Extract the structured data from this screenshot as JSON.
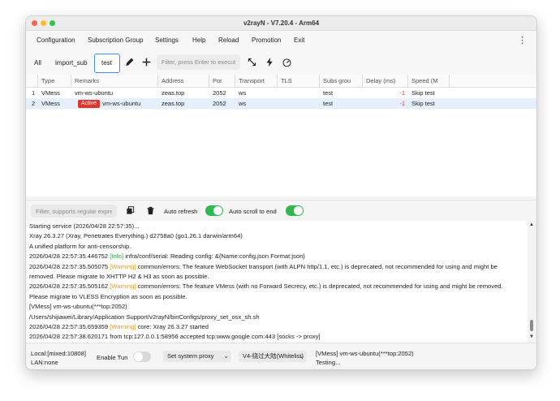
{
  "window": {
    "title": "v2rayN - V7.20.4 - Arm64"
  },
  "menu": [
    "Configuration",
    "Subscription Group",
    "Settings",
    "Help",
    "Reload",
    "Promotion",
    "Exit"
  ],
  "tabs": [
    "All",
    "import_sub",
    "test"
  ],
  "toolbar": {
    "filter_placeholder": "Filter, press Enter to execute"
  },
  "table": {
    "headers": [
      "Type",
      "Remarks",
      "Address",
      "Por",
      "Transport",
      "TLS",
      "Subs grou",
      "Delay (ms)",
      "Speed (M"
    ],
    "rows": [
      {
        "index": "1",
        "type": "VMess",
        "badge": "",
        "remarks": "vm-ws-ubuntu",
        "address": "zeas.top",
        "port": "2052",
        "transport": "ws",
        "tls": "",
        "subs": "test",
        "delay": "-1",
        "speed": "Skip test"
      },
      {
        "index": "2",
        "type": "VMess",
        "badge": "Active",
        "remarks": "vm-ws-ubuntu",
        "address": "zeas.top",
        "port": "2052",
        "transport": "ws",
        "tls": "",
        "subs": "test",
        "delay": "-1",
        "speed": "Skip test"
      }
    ]
  },
  "log_toolbar": {
    "filter_placeholder": "Filter, supports regular expressions",
    "auto_refresh_label": "Auto refresh",
    "auto_scroll_label": "Auto scroll to end"
  },
  "log": [
    [
      {
        "t": "Starting service (2026/04/28 22:57:35)..."
      }
    ],
    [
      {
        "t": "Xray 26.3.27 (Xray, Penetrates Everything.) d2758a0 (go1.26.1 darwin/arm64)"
      }
    ],
    [
      {
        "t": "A unified platform for anti-censorship."
      }
    ],
    [
      {
        "t": "2026/04/28 22:57:35.446752 "
      },
      {
        "t": "[Info]",
        "c": "info"
      },
      {
        "t": " infra/conf/serial: Reading config: &{Name:config.json Format:json}"
      }
    ],
    [
      {
        "t": "2026/04/28 22:57:35.505075 "
      },
      {
        "t": "[Warning]",
        "c": "warn"
      },
      {
        "t": " common/errors: The feature WebSocket transport (with ALPN http/1.1, etc.) is deprecated, not recommended for using and might be"
      }
    ],
    [
      {
        "t": "removed. Please migrate to XHTTP H2 & H3 as soon as possible."
      }
    ],
    [
      {
        "t": "2026/04/28 22:57:35.505162 "
      },
      {
        "t": "[Warning]",
        "c": "warn"
      },
      {
        "t": " common/errors: The feature VMess (with no Forward Secrecy, etc.) is deprecated, not recommended for using and might be removed."
      }
    ],
    [
      {
        "t": "Please migrate to VLESS Encryption as soon as possible."
      }
    ],
    [
      {
        "t": "[VMess] vm-ws-ubuntu(***top:2052)"
      }
    ],
    [
      {
        "t": "/Users/shijiawei/Library/Application Support/v2rayN/binConfigs/proxy_set_osx_sh.sh"
      }
    ],
    [
      {
        "t": "2026/04/28 22:57:35.659359 "
      },
      {
        "t": "[Warning]",
        "c": "warn"
      },
      {
        "t": " core: Xray 26.3.27 started"
      }
    ],
    [
      {
        "t": "2026/04/28 22:57:38.620171 from tcp:127.0.0.1:58956 accepted tcp:www.google.com:443 [socks -> proxy]"
      }
    ]
  ],
  "status": {
    "local": "Local:[mixed:10808]",
    "lan": "LAN:none",
    "tun_label": "Enable Tun",
    "system_proxy": "Set system proxy",
    "routing": "V4-绕过大陆(Whitelist)",
    "server": "[VMess] vm-ws-ubuntu(***top:2052)",
    "testing": "Testing..."
  },
  "colors": {
    "accent": "#3d8ef7",
    "toggle_on": "#2fb84f",
    "active_badge": "#e5322d",
    "warning": "#e79a1f",
    "info": "#2e9e47"
  }
}
